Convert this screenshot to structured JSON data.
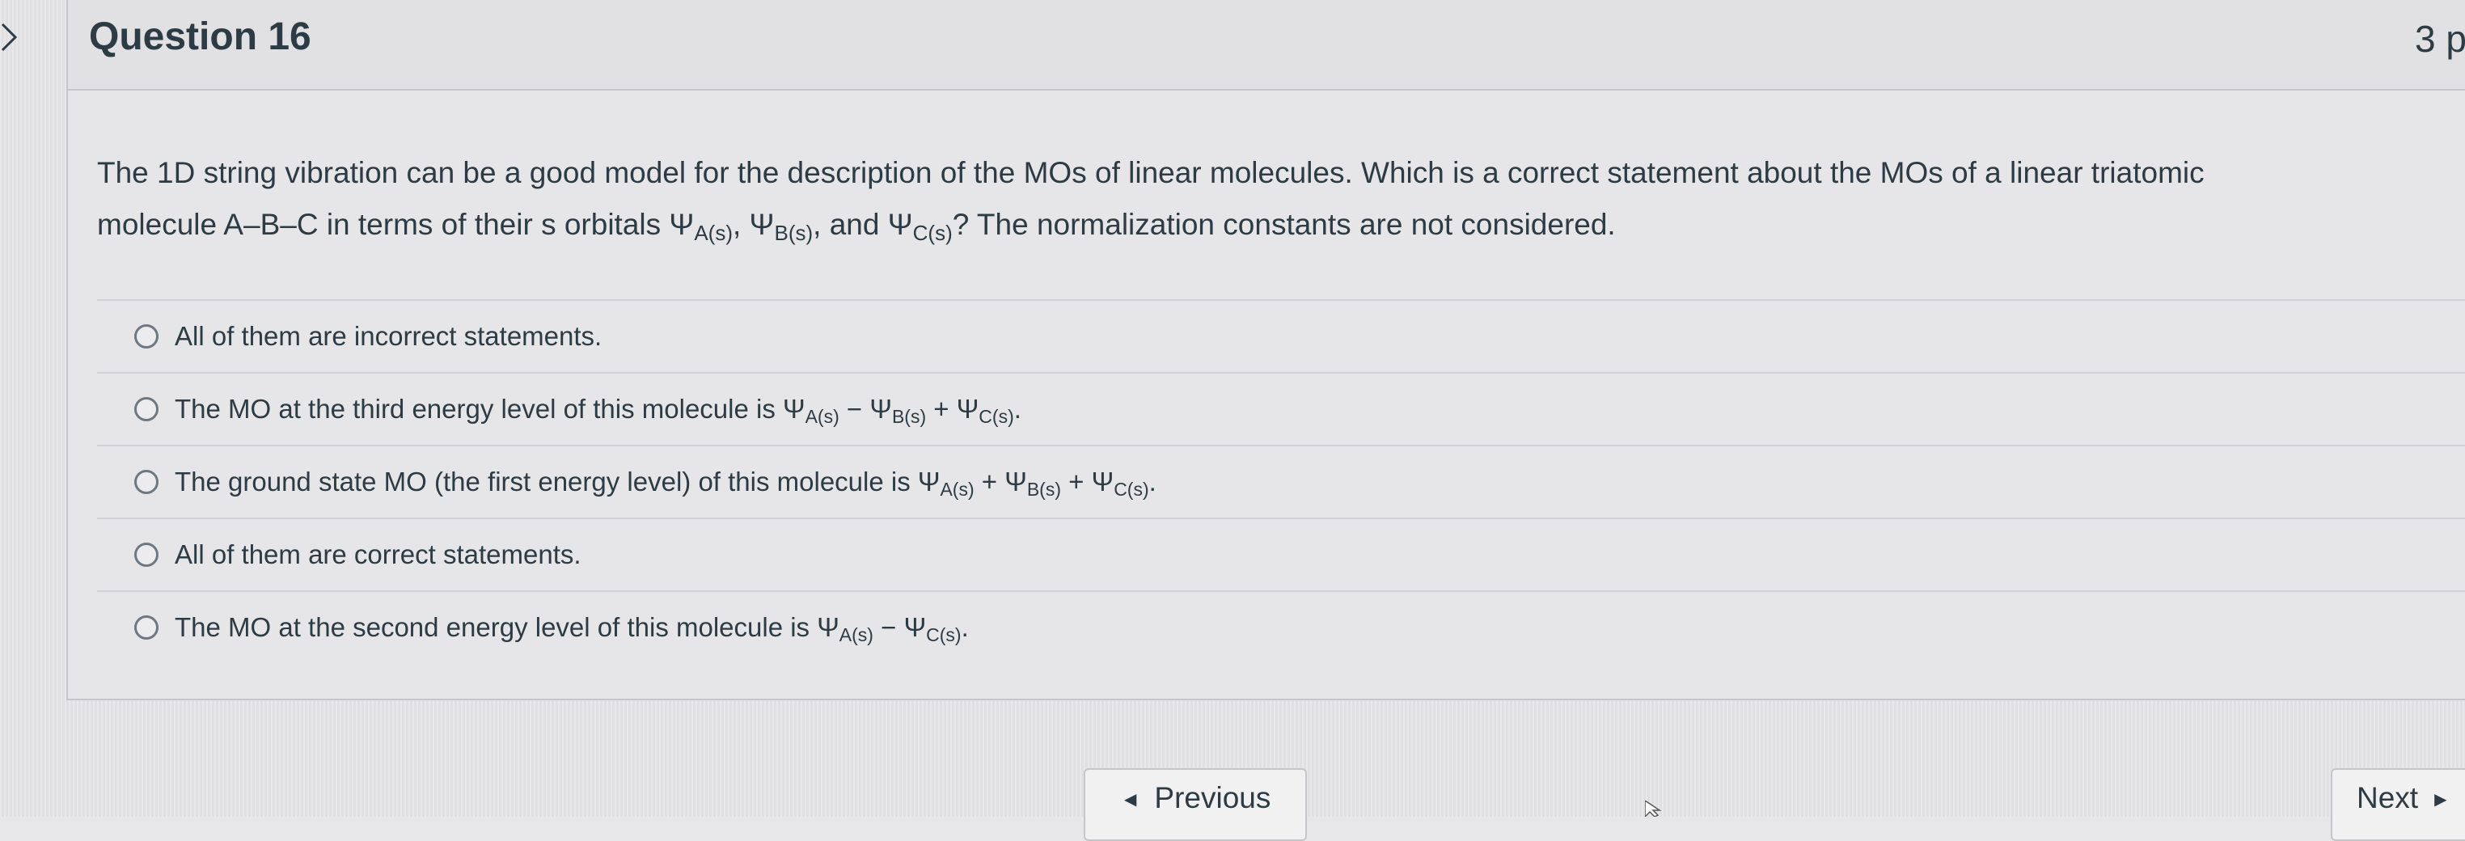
{
  "question": {
    "title": "Question 16",
    "points": "3 p",
    "text_line1": "The 1D string vibration can be a good model for the description of the MOs of linear molecules. Which is a correct statement about the MOs of a linear triatomic",
    "text_line2_a": "molecule A–B–C in terms of their s orbitals Ψ",
    "text_line2_sub_a": "A(s)",
    "text_line2_sep1": ", Ψ",
    "text_line2_sub_b": "B(s)",
    "text_line2_sep2": ", and Ψ",
    "text_line2_sub_c": "C(s)",
    "text_line2_end": "? The normalization constants are not considered."
  },
  "answers": [
    {
      "a": "All of them are incorrect statements."
    },
    {
      "a": "The MO at the third energy level of this molecule is Ψ",
      "s1": "A(s)",
      "b": " − Ψ",
      "s2": "B(s)",
      "c": " + Ψ",
      "s3": "C(s)",
      "d": "."
    },
    {
      "a": "The ground state MO (the first energy level) of this molecule is Ψ",
      "s1": "A(s)",
      "b": " + Ψ",
      "s2": "B(s)",
      "c": " + Ψ",
      "s3": "C(s)",
      "d": "."
    },
    {
      "a": "All of them are correct statements."
    },
    {
      "a": "The MO at the second energy level of this molecule is Ψ",
      "s1": "A(s)",
      "b": " − Ψ",
      "s2": "C(s)",
      "d": "."
    }
  ],
  "navigation": {
    "previous_label": "Previous",
    "next_label": "Next"
  },
  "icons": {
    "collapse": "chevron-right-icon",
    "previous": "triangle-left-icon",
    "next": "triangle-right-icon",
    "radio": "radio-button-icon"
  },
  "colors": {
    "text": "#2d3b45",
    "background": "#e7e7e9",
    "border": "#c4c6c9"
  }
}
